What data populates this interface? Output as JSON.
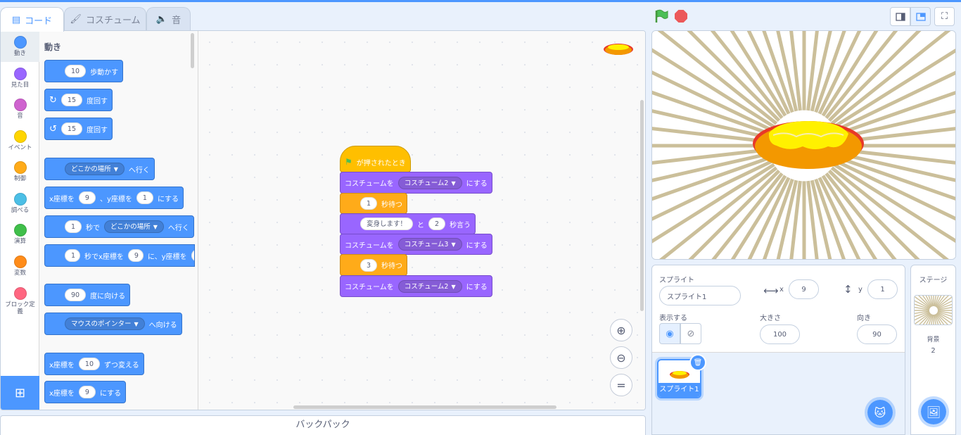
{
  "tabs": {
    "code": "コード",
    "costume": "コスチューム",
    "sound": "音"
  },
  "categories": [
    {
      "label": "動き",
      "color": "#4c97ff"
    },
    {
      "label": "見た目",
      "color": "#9966ff"
    },
    {
      "label": "音",
      "color": "#cf63cf"
    },
    {
      "label": "イベント",
      "color": "#ffd500"
    },
    {
      "label": "制御",
      "color": "#ffab19"
    },
    {
      "label": "調べる",
      "color": "#4cbfe6"
    },
    {
      "label": "演算",
      "color": "#40bf4a"
    },
    {
      "label": "変数",
      "color": "#ff8c1a"
    },
    {
      "label": "ブロック定義",
      "color": "#ff6680"
    }
  ],
  "palette": {
    "title": "動き",
    "move": {
      "value": "10",
      "text": "歩動かす"
    },
    "turn_right": {
      "value": "15",
      "text": "度回す"
    },
    "turn_left": {
      "value": "15",
      "text": "度回す"
    },
    "goto": {
      "target": "どこかの場所",
      "text": "へ行く"
    },
    "goto_xy": {
      "x_label": "x座標を",
      "x": "9",
      "sep": "、y座標を",
      "y": "1",
      "text": "にする"
    },
    "glide": {
      "secs": "1",
      "mid": "秒で",
      "target": "どこかの場所",
      "text": "へ行く"
    },
    "glide_xy": {
      "secs": "1",
      "mid": "秒でx座標を",
      "x": "9",
      "sep": "に、y座標を"
    },
    "point_dir": {
      "value": "90",
      "text": "度に向ける"
    },
    "point_towards": {
      "target": "マウスのポインター",
      "text": "へ向ける"
    },
    "change_x": {
      "label": "x座標を",
      "value": "10",
      "text": "ずつ変える"
    },
    "set_x": {
      "label": "x座標を",
      "value": "9",
      "text": "にする"
    }
  },
  "script": {
    "hat": "が押されたとき",
    "b1": {
      "label": "コスチュームを",
      "costume": "コスチューム2",
      "text": "にする"
    },
    "b2": {
      "value": "1",
      "text": "秒待つ"
    },
    "b3": {
      "message": "変身します！",
      "mid": "と",
      "secs": "2",
      "text": "秒言う"
    },
    "b4": {
      "label": "コスチュームを",
      "costume": "コスチューム3",
      "text": "にする"
    },
    "b5": {
      "value": "3",
      "text": "秒待つ"
    },
    "b6": {
      "label": "コスチュームを",
      "costume": "コスチューム2",
      "text": "にする"
    }
  },
  "backpack": "バックパック",
  "sprite_info": {
    "title": "スプライト",
    "name": "スプライト1",
    "x_label": "x",
    "x": "9",
    "y_label": "y",
    "y": "1",
    "show_label": "表示する",
    "size_label": "大きさ",
    "size": "100",
    "direction_label": "向き",
    "direction": "90"
  },
  "sprites": [
    {
      "name": "スプライト1"
    }
  ],
  "stage_pane": {
    "title": "ステージ",
    "backdrop_label": "背景",
    "backdrop_count": "2"
  },
  "colors": {
    "accent": "#4c97ff",
    "motion": "#4c97ff",
    "looks": "#9966ff",
    "control": "#ffab19",
    "events": "#ffbf00",
    "stop": "#ec5959",
    "go": "#4cbf56"
  }
}
